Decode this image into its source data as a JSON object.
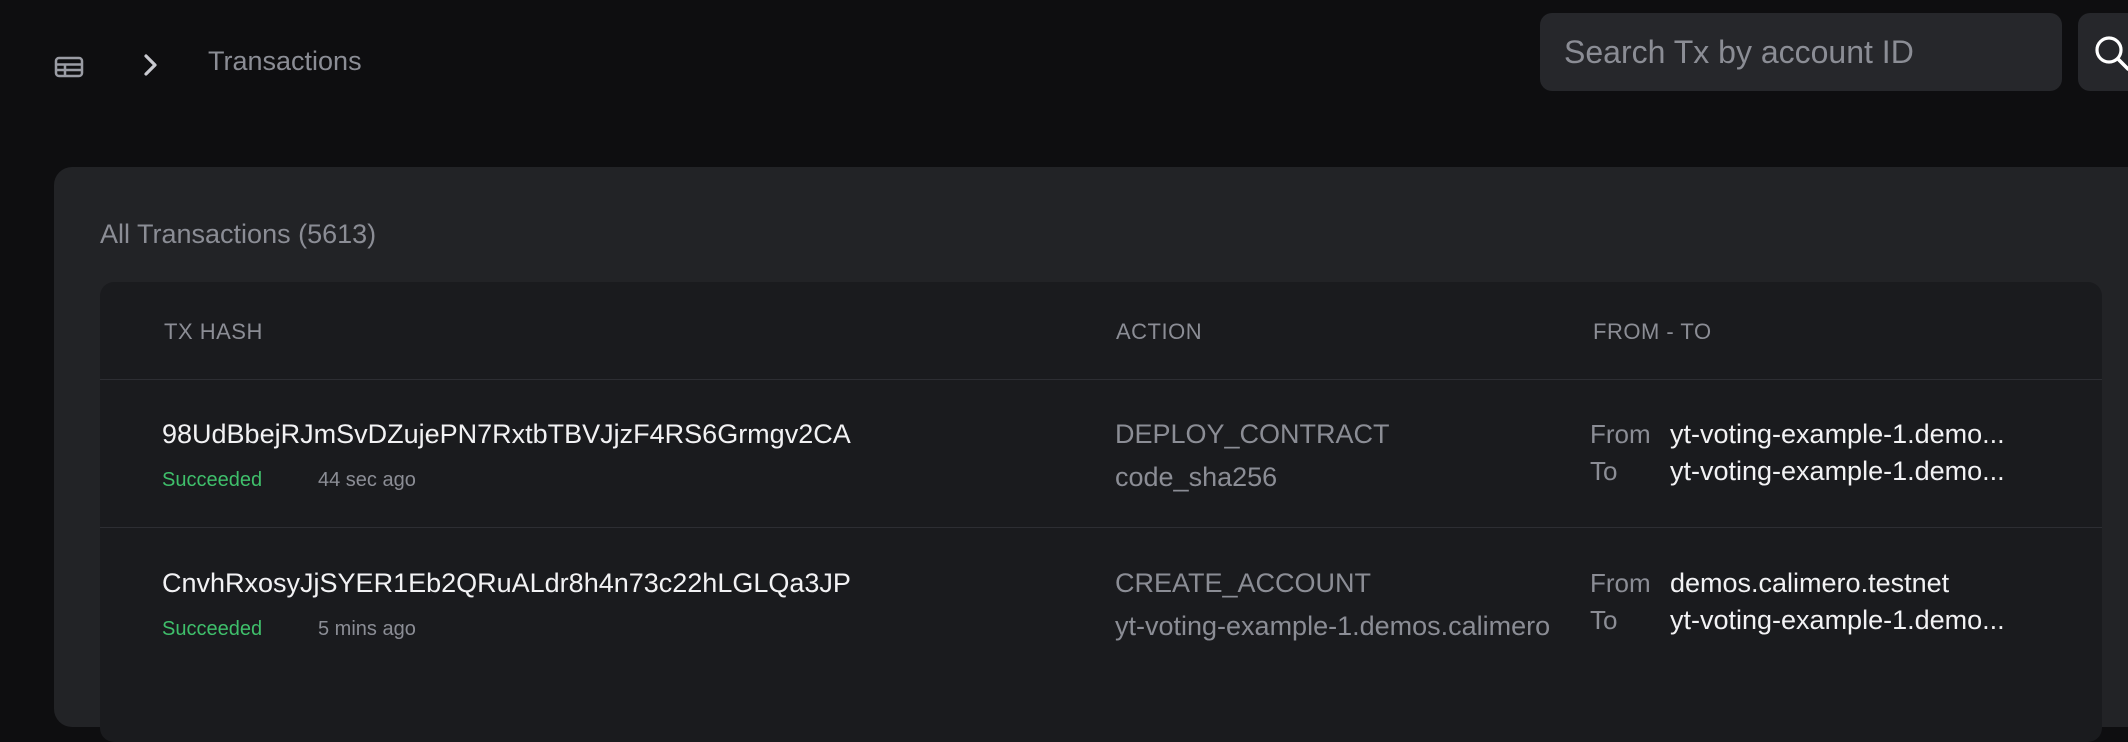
{
  "header": {
    "breadcrumb": "Transactions",
    "search": {
      "placeholder": "Search Tx by account ID",
      "value": ""
    }
  },
  "panel": {
    "title": "All Transactions (5613)",
    "columns": [
      "TX HASH",
      "ACTION",
      "FROM - TO"
    ],
    "rows": [
      {
        "hash": "98UdBbejRJmSvDZujePN7RxtbTBVJjzF4RS6Grmgv2CA",
        "status": "Succeeded",
        "age": "44 sec ago",
        "action": "DEPLOY_CONTRACT",
        "action_detail": "code_sha256",
        "from_label": "From",
        "from": "yt-voting-example-1.demo...",
        "to_label": "To",
        "to": "yt-voting-example-1.demo..."
      },
      {
        "hash": "CnvhRxosyJjSYER1Eb2QRuALdr8h4n73c22hLGLQa3JP",
        "status": "Succeeded",
        "age": "5 mins ago",
        "action": "CREATE_ACCOUNT",
        "action_detail": "yt-voting-example-1.demos.calimero",
        "from_label": "From",
        "from": "demos.calimero.testnet",
        "to_label": "To",
        "to": "yt-voting-example-1.demo..."
      }
    ]
  },
  "colors": {
    "background": "#0e0e10",
    "panel": "#222326",
    "table": "#1a1b1e",
    "success": "#3fbf6b",
    "muted": "#8b8d95"
  },
  "icons": [
    "table-icon",
    "chevron-right-icon",
    "search-icon"
  ]
}
